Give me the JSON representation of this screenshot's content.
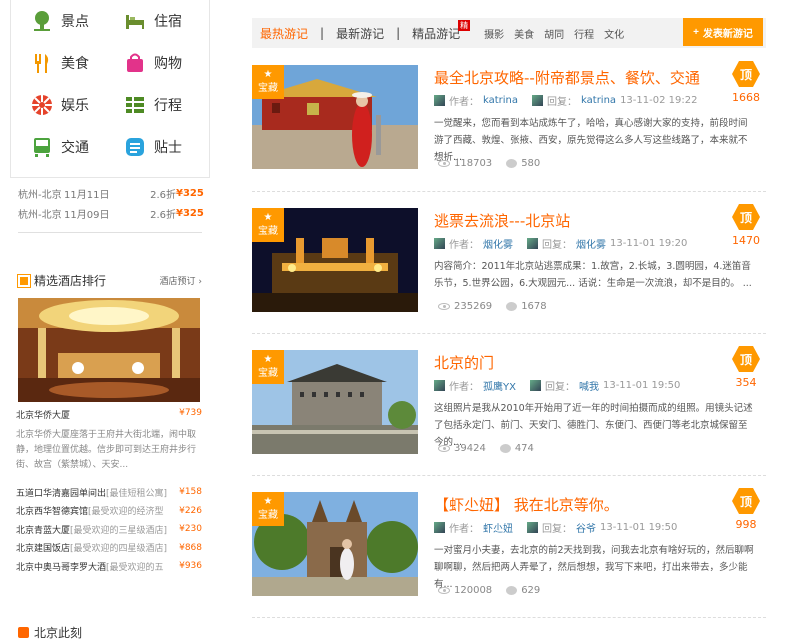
{
  "categories": [
    {
      "label": "景点",
      "icon": "tree-icon",
      "color": "#5a9e3a"
    },
    {
      "label": "住宿",
      "icon": "bed-icon",
      "color": "#6a8e2e"
    },
    {
      "label": "美食",
      "icon": "fork-knife-icon",
      "color": "#f39800"
    },
    {
      "label": "购物",
      "icon": "shopping-bag-icon",
      "color": "#e2338a"
    },
    {
      "label": "娱乐",
      "icon": "candy-icon",
      "color": "#e5432b"
    },
    {
      "label": "行程",
      "icon": "list-icon",
      "color": "#4e8a24"
    },
    {
      "label": "交通",
      "icon": "train-icon",
      "color": "#4ca33e"
    },
    {
      "label": "贴士",
      "icon": "tip-icon",
      "color": "#2aa3dd"
    }
  ],
  "flights": [
    {
      "route": "杭州-北京",
      "date": "11月11日",
      "discount": "2.6折",
      "price": "¥325"
    },
    {
      "route": "杭州-北京",
      "date": "11月09日",
      "discount": "2.6折",
      "price": "¥325"
    }
  ],
  "hotels": {
    "title": "精选酒店排行",
    "more": "酒店预订 ›",
    "featured_name": "北京华侨大厦",
    "featured_price": "¥739",
    "featured_desc": "北京华侨大厦座落于王府井大街北端，闹中取静，地理位置优越。信步即可到达王府井步行街、故宫（紫禁城）、天安...",
    "list": [
      {
        "name": "五道口华清嘉园单间出",
        "tag": "[最佳短租公寓]",
        "price": "¥158"
      },
      {
        "name": "北京西华智德宾馆",
        "tag": "[最受欢迎的经济型",
        "price": "¥226"
      },
      {
        "name": "北京青蓝大厦",
        "tag": "[最受欢迎的三星级酒店]",
        "price": "¥230"
      },
      {
        "name": "北京建国饭店",
        "tag": "[最受欢迎的四星级酒店]",
        "price": "¥868"
      },
      {
        "name": "北京中奥马哥孛罗大酒",
        "tag": "[最受欢迎的五",
        "price": "¥936"
      }
    ]
  },
  "beijing_now": "北京此刻",
  "tabs": {
    "hot": "最热游记",
    "new": "最新游记",
    "best": "精品游记",
    "best_badge": "精",
    "filters": [
      "摄影",
      "美食",
      "胡同",
      "行程",
      "文化"
    ],
    "post_button": "发表新游记"
  },
  "ribbon": "宝藏",
  "top_label": "顶",
  "posts": [
    {
      "title": "最全北京攻略--附帝都景点、餐饮、交通",
      "votes": "1668",
      "author_label": "作者：",
      "author": "katrina",
      "reply_label": "回复：",
      "replier": "katrina",
      "date": "13-11-02 19:22",
      "excerpt": "一觉醒来，您而看到本站成炼午了，哈哈，真心感谢大家的支持，前段时间游了西藏、敦煌、张掖、西安，原先觉得这么多人写这些线路了，本来就不想折...",
      "views": "118703",
      "comments": "580"
    },
    {
      "title": "逃票去流浪---北京站",
      "votes": "1470",
      "author_label": "作者：",
      "author": "烟化雾",
      "reply_label": "回复：",
      "replier": "烟化雾",
      "date": "13-11-01 19:20",
      "excerpt": "内容简介：2011年北京站逃票成果：1.故宫，2.长城，3.圆明园，4.迷笛音乐节，5.世界公园，6.大观园元...  话说：生命是一次流浪，却不是目的。 ...",
      "views": "235269",
      "comments": "1678"
    },
    {
      "title": "北京的门",
      "votes": "354",
      "author_label": "作者：",
      "author": "孤鹰YX",
      "reply_label": "回复：",
      "replier": "喊我",
      "date": "13-11-01 19:50",
      "excerpt": "这组照片是我从2010年开始用了近一年的时间拍摄而成的组照。用镜头记述了包括永定门、前门、天安门、德胜门、东便门、西便门等老北京城保留至今的...",
      "views": "39424",
      "comments": "474"
    },
    {
      "title": "【虾尐妞】 我在北京等你。",
      "votes": "998",
      "author_label": "作者：",
      "author": "虾尐妞",
      "reply_label": "回复：",
      "replier": "谷爷",
      "date": "13-11-01 19:50",
      "excerpt": "一对蜜月小夫妻，去北京的前2天找到我，问我去北京有啥好玩的，然后聊啊聊啊聊，然后把两人弄晕了，然后想想，我写下来吧，打出来带去，多少能有...",
      "views": "120008",
      "comments": "629"
    }
  ]
}
